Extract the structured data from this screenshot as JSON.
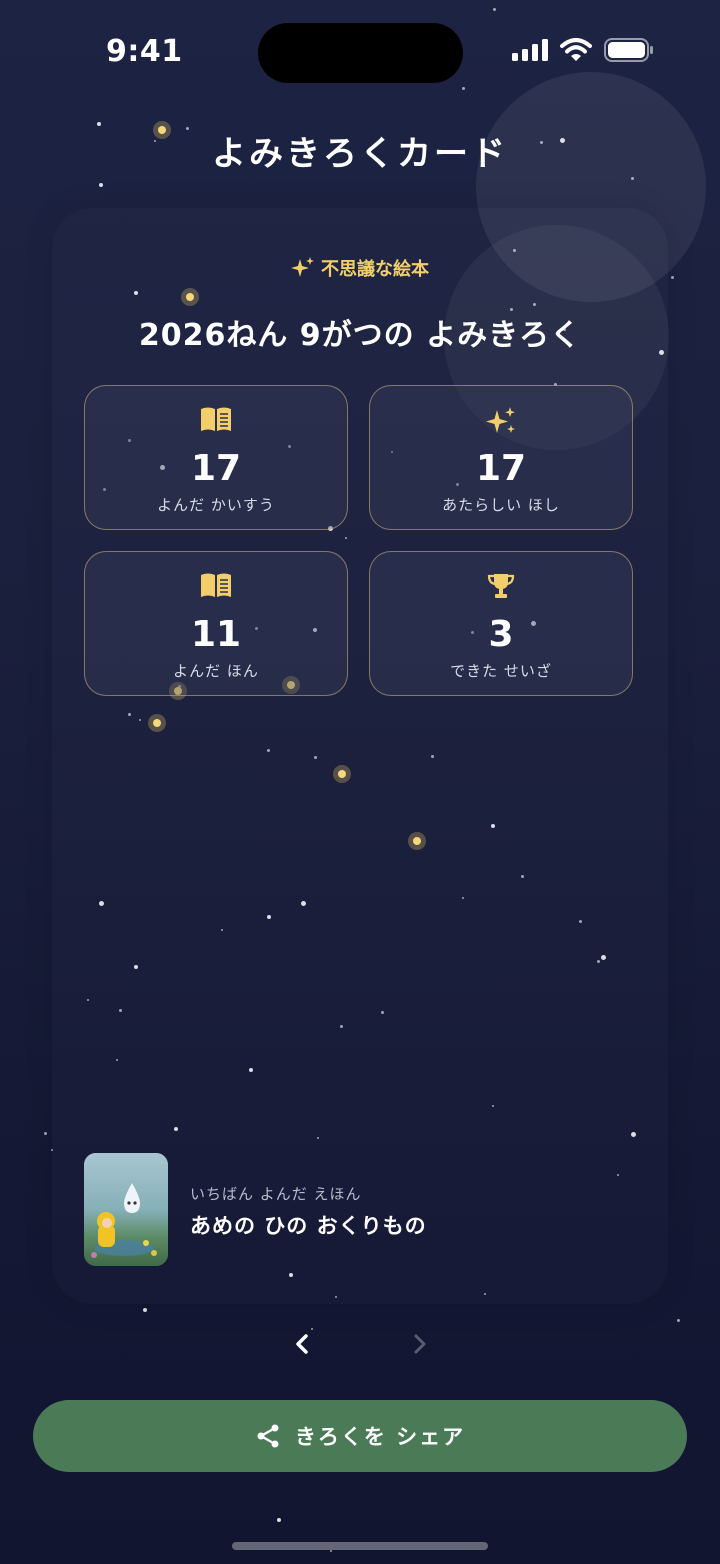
{
  "status_bar": {
    "time": "9:41"
  },
  "header": {
    "title": "よみきろくカード"
  },
  "card": {
    "subtitle": "不思議な絵本",
    "heading": "2026ねん 9がつの よみきろく",
    "stats": [
      {
        "icon": "open-book-icon",
        "value": "17",
        "label": "よんだ かいすう"
      },
      {
        "icon": "sparkles-icon",
        "value": "17",
        "label": "あたらしい ほし"
      },
      {
        "icon": "open-book-icon",
        "value": "11",
        "label": "よんだ ほん"
      },
      {
        "icon": "trophy-icon",
        "value": "3",
        "label": "できた せいざ"
      }
    ],
    "top_book": {
      "kicker": "いちばん よんだ えほん",
      "title": "あめの ひの おくりもの"
    }
  },
  "pager": {
    "prev_icon": "chevron-left-icon",
    "next_icon": "chevron-right-icon"
  },
  "share_button": {
    "label": "きろくを シェア",
    "icon": "share-icon"
  },
  "colors": {
    "gold": "#f2cf6b",
    "share_green": "#4a7a56",
    "background": "#1a1f3c"
  }
}
